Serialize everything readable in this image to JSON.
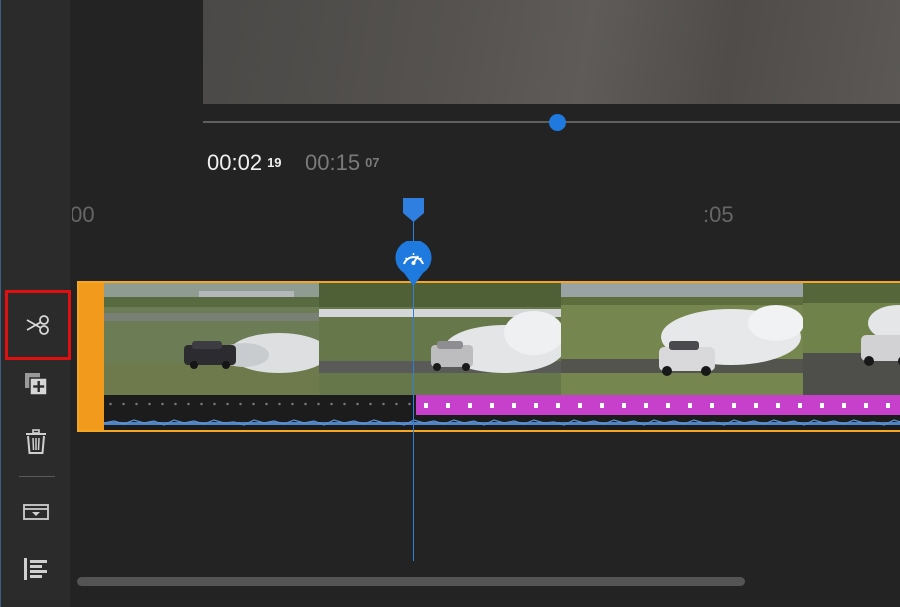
{
  "timecode": {
    "current_main": "00:02",
    "current_frames": "19",
    "total_main": "00:15",
    "total_frames": "07"
  },
  "ruler": {
    "left_label": ":00",
    "mid_label": ":05"
  },
  "icons": {
    "split": "scissors-icon",
    "duplicate": "duplicate-icon",
    "delete": "trash-icon",
    "track": "track-expand-icon",
    "align": "align-icon",
    "playhead": "playhead-marker-icon",
    "speed": "speedometer-icon"
  },
  "colors": {
    "accent": "#1f7ae0",
    "clip_border": "#f5a623",
    "clip_handle": "#f29a1c",
    "effect_bar": "#c640cc",
    "highlight": "#e01010"
  }
}
